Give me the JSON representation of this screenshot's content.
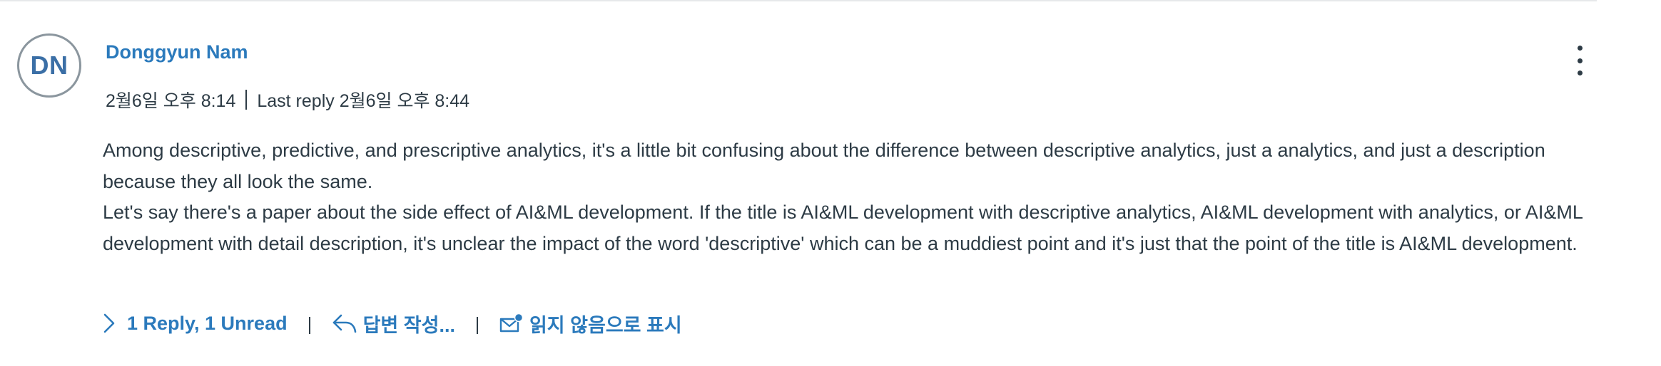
{
  "entry": {
    "avatar_initials": "DN",
    "author": "Donggyun Nam",
    "posted_at": "2월6일 오후 8:14",
    "last_reply": "Last reply 2월6일 오후 8:44",
    "message": [
      "Among descriptive, predictive, and prescriptive analytics, it's a little bit confusing about the difference between descriptive analytics, just a analytics, and just a description because they all look the same.",
      "Let's say there's a paper about the side effect of AI&ML development. If the title is AI&ML development with descriptive analytics, AI&ML development with analytics, or AI&ML development with detail description, it's unclear the impact of the word 'descriptive' which can be a muddiest point and it's just that the point of the title is AI&ML development."
    ],
    "actions": {
      "replies_label": "1 Reply, 1 Unread",
      "reply_label": "답변 작성...",
      "mark_unread_label": "읽지 않음으로 표시"
    }
  },
  "colors": {
    "link": "#2b7abc",
    "text": "#2d3b45",
    "avatar_border": "#8b969e",
    "avatar_text": "#3b6fa6"
  },
  "icons": [
    "chevron-right-icon",
    "reply-arrow-icon",
    "mail-unread-icon",
    "more-options-icon"
  ]
}
